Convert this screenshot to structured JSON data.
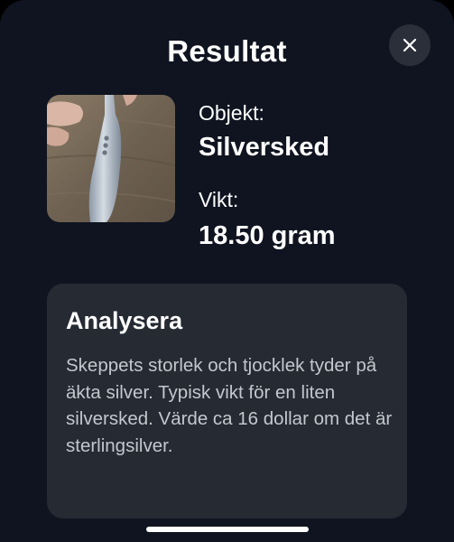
{
  "header": {
    "title": "Resultat",
    "close_icon": "close-icon"
  },
  "result": {
    "image_icon": "spoon-photo",
    "object_label": "Objekt:",
    "object_value": "Silversked",
    "weight_label": "Vikt:",
    "weight_value": "18.50 gram"
  },
  "analysis": {
    "title": "Analysera",
    "text": "Skeppets storlek och tjocklek tyder på äkta silver. Typisk vikt för en liten silversked. Värde ca 16 dollar om det är sterlingsilver."
  },
  "colors": {
    "background": "#0f1420",
    "card": "#252a33",
    "close_button": "#2a2f3a",
    "text_primary": "#ffffff",
    "text_secondary": "#c4c7cd"
  }
}
